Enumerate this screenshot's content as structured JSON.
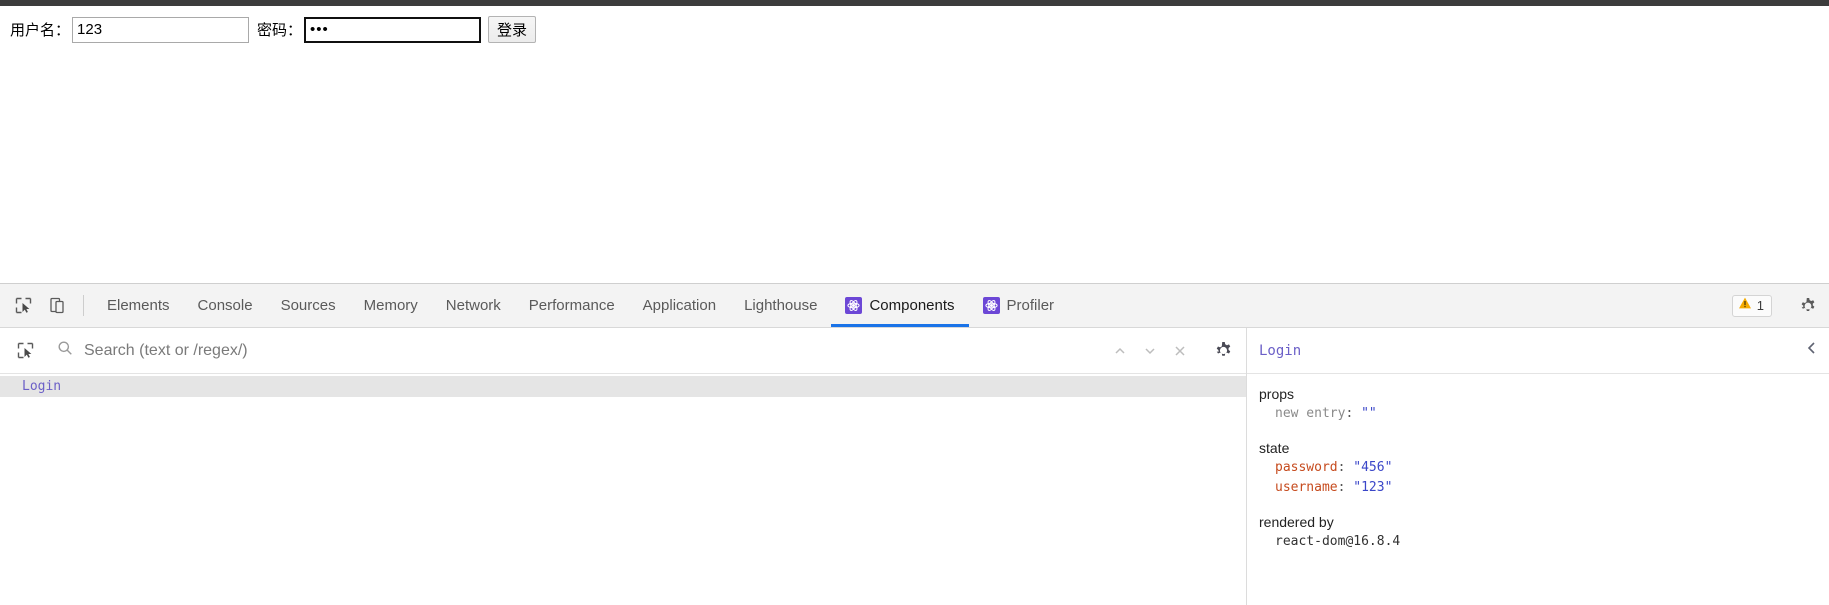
{
  "page": {
    "form": {
      "username_label": "用户名：",
      "username_value": "123",
      "password_label": "密码：",
      "password_value": "•••",
      "submit_label": "登录"
    }
  },
  "devtools": {
    "tabs": [
      {
        "label": "Elements",
        "icon": null,
        "active": false
      },
      {
        "label": "Console",
        "icon": null,
        "active": false
      },
      {
        "label": "Sources",
        "icon": null,
        "active": false
      },
      {
        "label": "Memory",
        "icon": null,
        "active": false
      },
      {
        "label": "Network",
        "icon": null,
        "active": false
      },
      {
        "label": "Performance",
        "icon": null,
        "active": false
      },
      {
        "label": "Application",
        "icon": null,
        "active": false
      },
      {
        "label": "Lighthouse",
        "icon": null,
        "active": false
      },
      {
        "label": "Components",
        "icon": "react-icon",
        "active": true
      },
      {
        "label": "Profiler",
        "icon": "react-icon",
        "active": false
      }
    ],
    "toolbar_icons": {
      "inspect": "inspect-element-icon",
      "device": "device-toolbar-icon"
    },
    "warnings": {
      "icon": "warning-triangle-icon",
      "count": "1"
    },
    "settings_icon": "gear-icon",
    "accent_color": "#1a73e8",
    "react_purple": "#6c47d6"
  },
  "components": {
    "search": {
      "placeholder": "Search (text or /regex/)",
      "value": "",
      "icon": "search-icon",
      "select_icon": "select-component-icon",
      "prev_icon": "chevron-up-icon",
      "next_icon": "chevron-down-icon",
      "clear_icon": "close-icon",
      "settings_icon": "gear-icon"
    },
    "tree": [
      {
        "label": "Login",
        "selected": true
      }
    ],
    "detail": {
      "title": "Login",
      "collapse_icon": "chevron-left-icon",
      "sections": [
        {
          "name": "props",
          "rows": [
            {
              "key": "new entry",
              "key_style": "dim",
              "value": "\"\""
            }
          ]
        },
        {
          "name": "state",
          "rows": [
            {
              "key": "password",
              "key_style": "name",
              "value": "\"456\""
            },
            {
              "key": "username",
              "key_style": "name",
              "value": "\"123\""
            }
          ]
        },
        {
          "name": "rendered by",
          "rows": [
            {
              "key": "react-dom@16.8.4",
              "key_style": "plain",
              "value": ""
            }
          ]
        }
      ]
    }
  }
}
